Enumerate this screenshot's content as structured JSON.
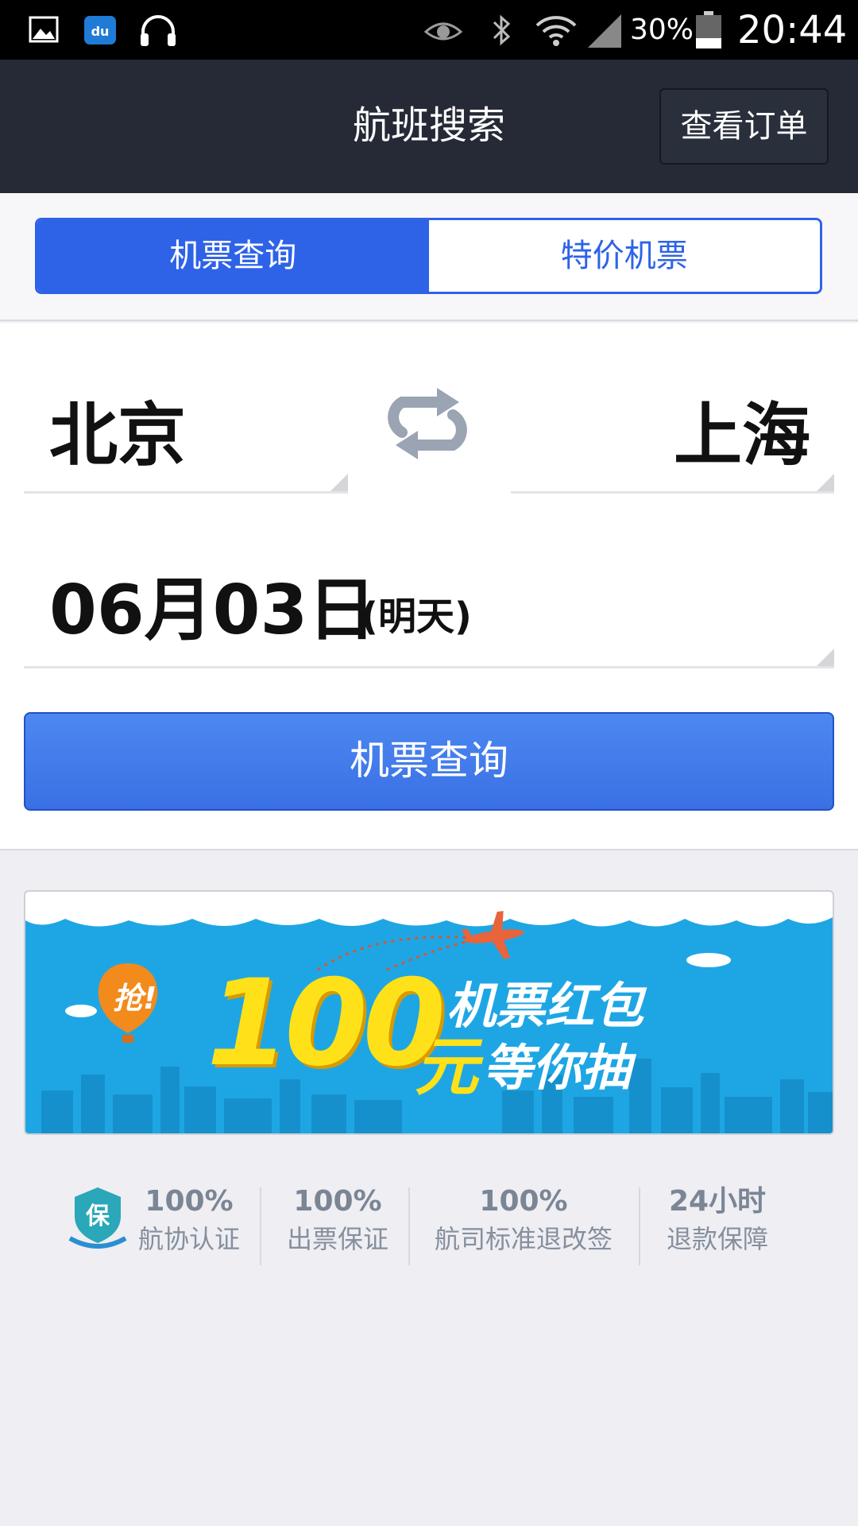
{
  "status_bar": {
    "battery": "30%",
    "time": "20:44",
    "icons": [
      "gallery-icon",
      "baidu-du-icon",
      "headphones-icon",
      "eye-icon",
      "bluetooth-icon",
      "wifi-icon",
      "signal-icon",
      "battery-icon"
    ]
  },
  "header": {
    "title": "航班搜索",
    "order_button": "查看订单"
  },
  "tabs": [
    {
      "label": "机票查询",
      "active": true
    },
    {
      "label": "特价机票",
      "active": false
    }
  ],
  "search": {
    "from_city": "北京",
    "to_city": "上海",
    "date": "06月03日",
    "date_note": "(明天)",
    "button_label": "机票查询"
  },
  "banner": {
    "badge": "抢!",
    "amount": "100",
    "unit": "元",
    "line1": "机票红包",
    "line2": "等你抽"
  },
  "guarantees": [
    {
      "value": "100%",
      "label": "航协认证"
    },
    {
      "value": "100%",
      "label": "出票保证"
    },
    {
      "value": "100%",
      "label": "航司标准退改签"
    },
    {
      "value": "24小时",
      "label": "退款保障"
    }
  ],
  "colors": {
    "accent": "#2e63e8",
    "header_bg": "#252a36",
    "banner_bg": "#1ea6e4",
    "banner_yellow": "#ffe11a"
  }
}
